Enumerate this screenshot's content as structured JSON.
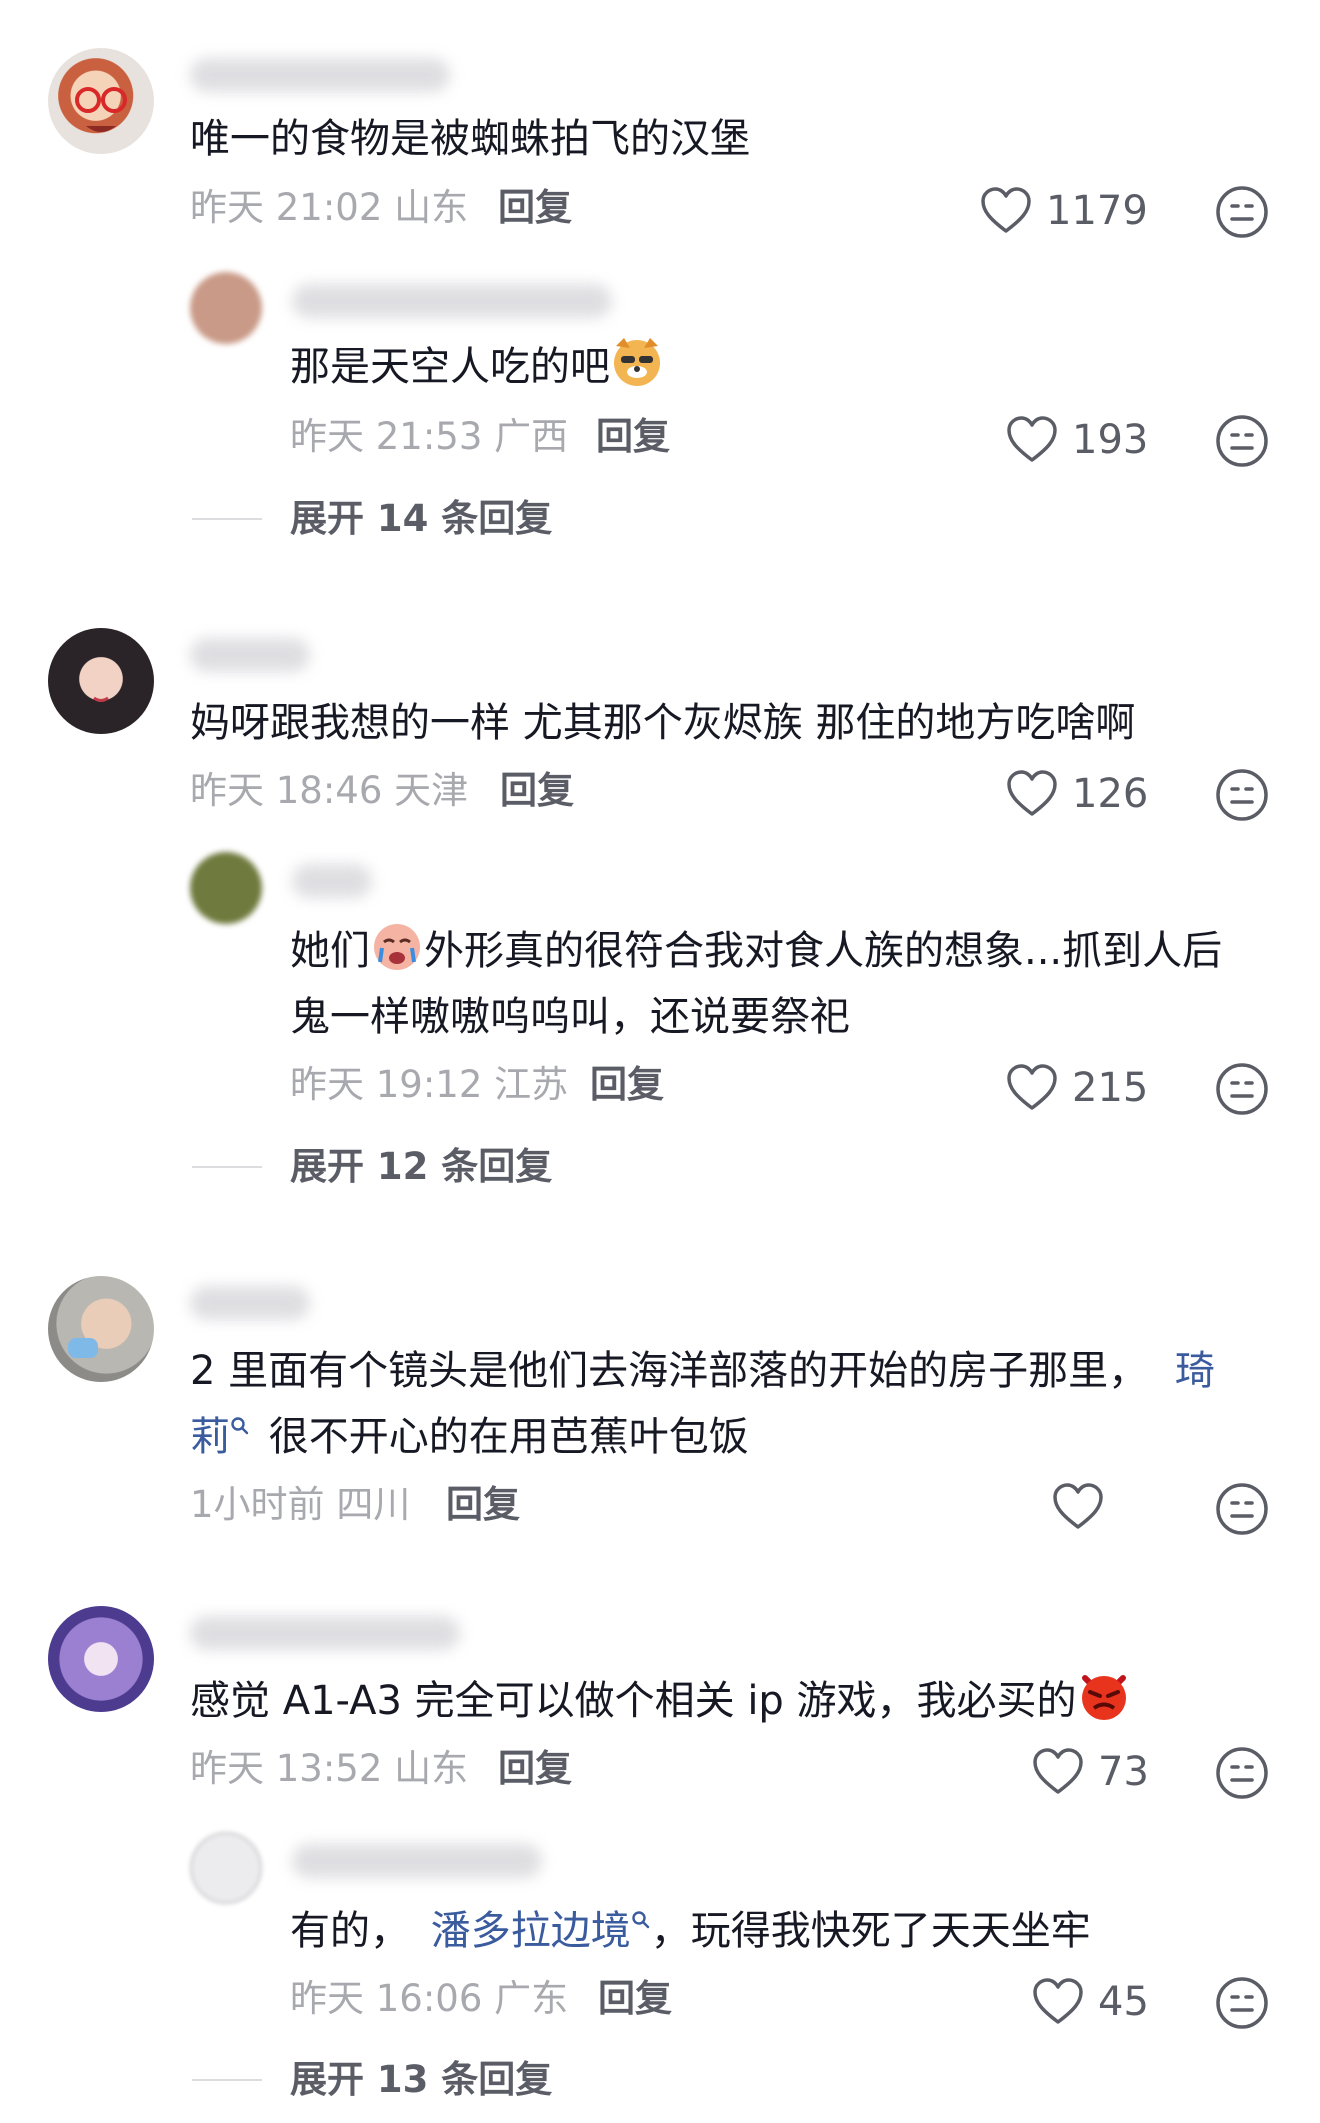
{
  "comments": [
    {
      "text": "唯一的食物是被蜘蛛拍飞的汉堡",
      "time": "昨天 21:02",
      "location": "山东",
      "reply_label": "回复",
      "likes": "1179",
      "replies": [
        {
          "text": "那是天空人吃的吧",
          "time": "昨天 21:53",
          "location": "广西",
          "reply_label": "回复",
          "likes": "193"
        }
      ],
      "expand_label": "展开 14 条回复"
    },
    {
      "text": "妈呀跟我想的一样 尤其那个灰烬族 那住的地方吃啥啊",
      "time": "昨天 18:46",
      "location": "天津",
      "reply_label": "回复",
      "likes": "126",
      "replies": [
        {
          "text_prefix": "她们",
          "text_line1": "外形真的很符合我对食人族的想象...抓到人后",
          "text_line2": "鬼一样嗷嗷呜呜叫，还说要祭祀",
          "time": "昨天 19:12",
          "location": "江苏",
          "reply_label": "回复",
          "likes": "215"
        }
      ],
      "expand_label": "展开 12 条回复"
    },
    {
      "text_line1": "2 里面有个镜头是他们去海洋部落的开始的房子那里，",
      "link_part1": "琦",
      "link_part2": "莉",
      "text_line2": "很不开心的在用芭蕉叶包饭",
      "time": "1小时前",
      "location": "四川",
      "reply_label": "回复",
      "likes": ""
    },
    {
      "text": "感觉 A1-A3 完全可以做个相关 ip 游戏，我必买的",
      "time": "昨天 13:52",
      "location": "山东",
      "reply_label": "回复",
      "likes": "73",
      "replies": [
        {
          "text_prefix": "有的，",
          "link": "潘多拉边境",
          "text_suffix": "，玩得我快死了天天坐牢",
          "time": "昨天 16:06",
          "location": "广东",
          "reply_label": "回复",
          "likes": "45"
        }
      ],
      "expand_label": "展开 13 条回复"
    }
  ],
  "icons": {
    "like": "heart-outline-icon",
    "dislike": "neutral-face-icon",
    "search_link": "search-mini-icon"
  },
  "colors": {
    "text": "#161823",
    "meta": "#a8a9ae",
    "link": "#3a5b9e",
    "action": "#5b5d66"
  }
}
